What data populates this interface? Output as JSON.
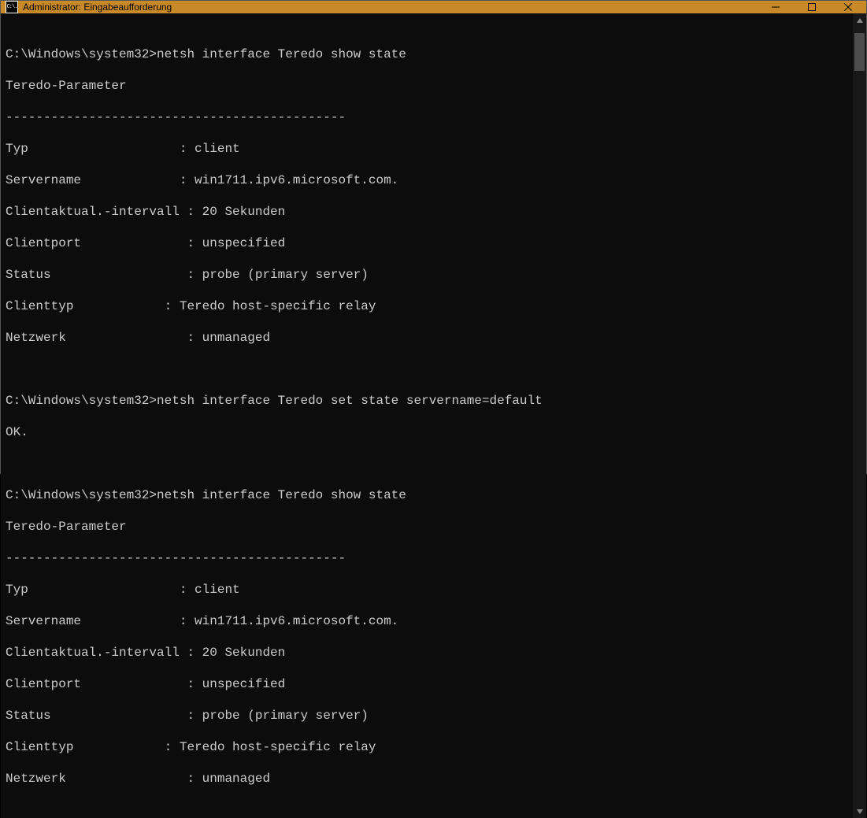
{
  "window": {
    "title": "Administrator: Eingabeaufforderung",
    "icon_text": "C:\\."
  },
  "terminal": {
    "blank": "",
    "prompt1": "C:\\Windows\\system32>netsh interface Teredo show state",
    "header1": "Teredo-Parameter",
    "rule": "---------------------------------------------",
    "b1r1": "Typ                    : client",
    "b1r2": "Servername             : win1711.ipv6.microsoft.com.",
    "b1r3": "Clientaktual.-intervall : 20 Sekunden",
    "b1r4": "Clientport              : unspecified",
    "b1r5": "Status                  : probe (primary server)",
    "b1r6": "Clienttyp            : Teredo host-specific relay",
    "b1r7": "Netzwerk                : unmanaged",
    "prompt2": "C:\\Windows\\system32>netsh interface Teredo set state servername=default",
    "ok": "OK.",
    "prompt3": "C:\\Windows\\system32>netsh interface Teredo show state",
    "header2": "Teredo-Parameter",
    "b2r1": "Typ                    : client",
    "b2r2": "Servername             : win1711.ipv6.microsoft.com.",
    "b2r3": "Clientaktual.-intervall : 20 Sekunden",
    "b2r4": "Clientport              : unspecified",
    "b2r5": "Status                  : probe (primary server)",
    "b2r6": "Clienttyp            : Teredo host-specific relay",
    "b2r7": "Netzwerk                : unmanaged"
  }
}
